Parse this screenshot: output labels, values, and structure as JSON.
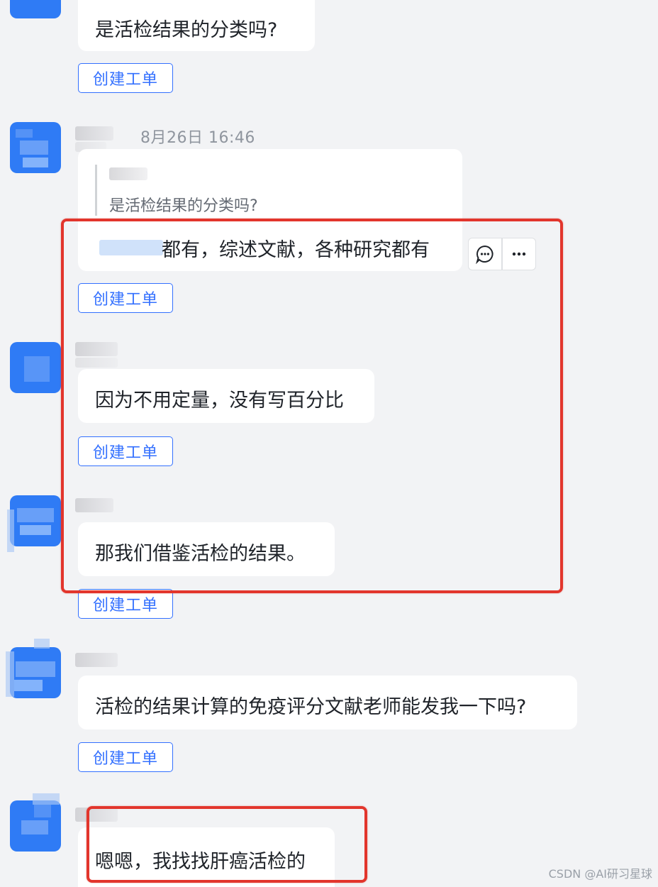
{
  "messages": [
    {
      "text": "是活检结果的分类吗?",
      "button": "创建工单"
    },
    {
      "time": "8月26日 16:46",
      "quote": {
        "text": "是活检结果的分类吗?"
      },
      "text": "都有，综述文献，各种研究都有",
      "button": "创建工单"
    },
    {
      "text": "因为不用定量，没有写百分比",
      "button": "创建工单"
    },
    {
      "text": "那我们借鉴活检的结果。",
      "button": "创建工单"
    },
    {
      "text": "活检的结果计算的免疫评分文献老师能发我一下吗?",
      "button": "创建工单"
    },
    {
      "text": "嗯嗯，我找找肝癌活检的"
    }
  ],
  "hover_actions": [
    {
      "icon": "reply-comment-icon"
    },
    {
      "icon": "more-icon"
    }
  ],
  "highlight_color": "#e2352c",
  "accent_color": "#3370ff",
  "watermark": "CSDN @AI研习星球"
}
